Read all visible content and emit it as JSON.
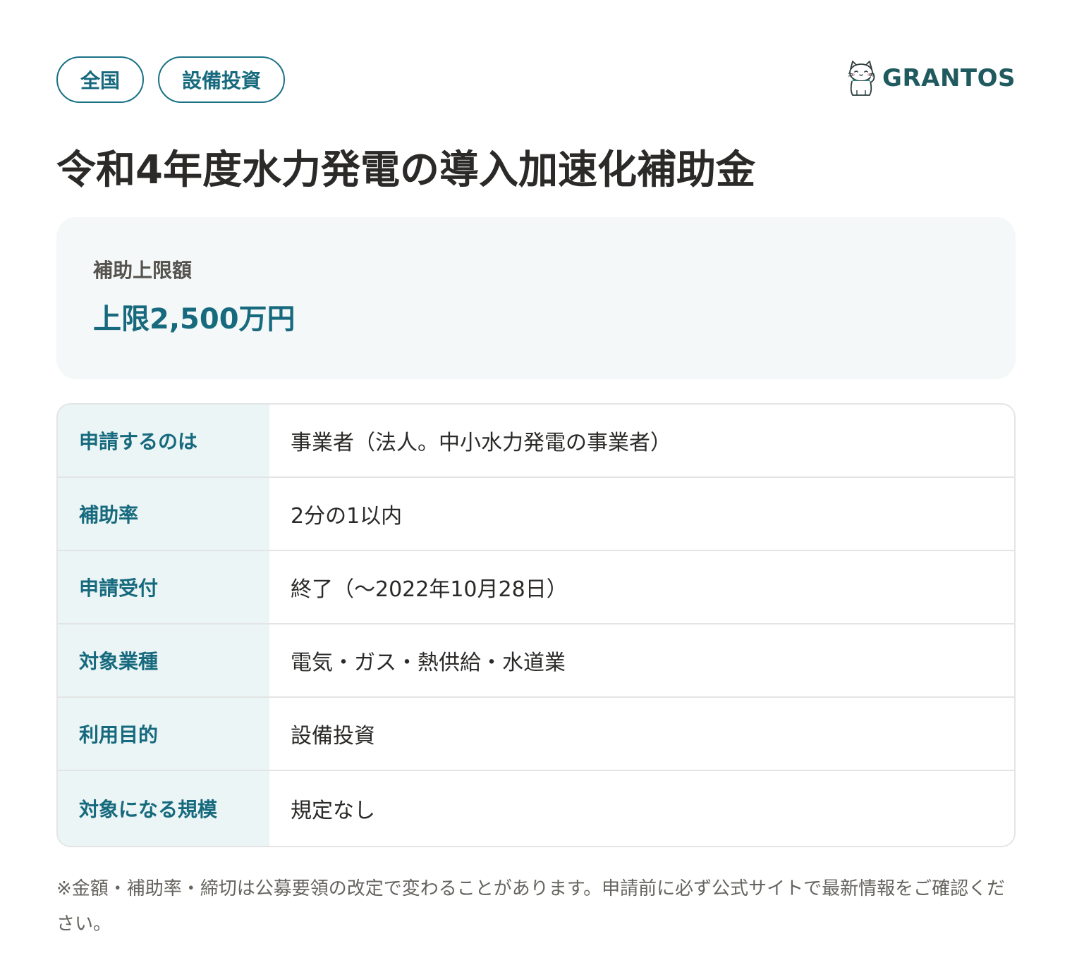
{
  "tags": [
    "全国",
    "設備投資"
  ],
  "logo": {
    "text": "GRANTOS",
    "icon": "maneki-neko-cat-icon"
  },
  "title": "令和4年度水力発電の導入加速化補助金",
  "amount": {
    "label": "補助上限額",
    "value": "上限2,500万円"
  },
  "details": [
    {
      "label": "申請するのは",
      "value": "事業者（法人。中小水力発電の事業者）"
    },
    {
      "label": "補助率",
      "value": "2分の1以内"
    },
    {
      "label": "申請受付",
      "value": "終了（〜2022年10月28日）"
    },
    {
      "label": "対象業種",
      "value": "電気・ガス・熱供給・水道業"
    },
    {
      "label": "利用目的",
      "value": "設備投資"
    },
    {
      "label": "対象になる規模",
      "value": "規定なし"
    }
  ],
  "note": "※金額・補助率・締切は公募要領の改定で変わることがあります。申請前に必ず公式サイトで最新情報をご確認ください。",
  "colors": {
    "accent": "#176a7e",
    "label_bg": "#ebf5f6",
    "card_bg": "#f5f8f9",
    "logo": "#1f5a5f"
  }
}
